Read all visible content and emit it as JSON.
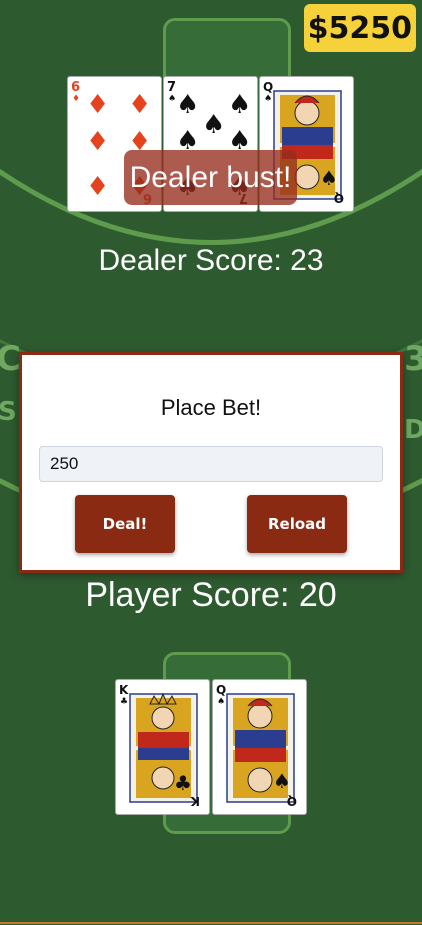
{
  "money": {
    "amount": "$5250"
  },
  "dealer": {
    "message": "Dealer bust!",
    "score_text": "Dealer Score: 23",
    "cards": [
      {
        "rank": "6",
        "suit": "diamonds",
        "suit_symbol": "♦",
        "color": "#e5431e"
      },
      {
        "rank": "7",
        "suit": "spades",
        "suit_symbol": "♠",
        "color": "#111111"
      },
      {
        "rank": "Q",
        "suit": "spades",
        "suit_symbol": "♠",
        "color": "#111111"
      }
    ]
  },
  "player": {
    "score_text": "Player Score: 20",
    "cards": [
      {
        "rank": "K",
        "suit": "clubs",
        "suit_symbol": "♣",
        "color": "#111111"
      },
      {
        "rank": "Q",
        "suit": "spades",
        "suit_symbol": "♠",
        "color": "#111111"
      }
    ]
  },
  "bet_modal": {
    "title": "Place Bet!",
    "bet_value": "250",
    "deal_label": "Deal!",
    "reload_label": "Reload"
  },
  "colors": {
    "felt": "#2e5a30",
    "felt_line": "#5f9b4c",
    "button": "#8b2a12",
    "money_bg": "#f6d23a"
  }
}
